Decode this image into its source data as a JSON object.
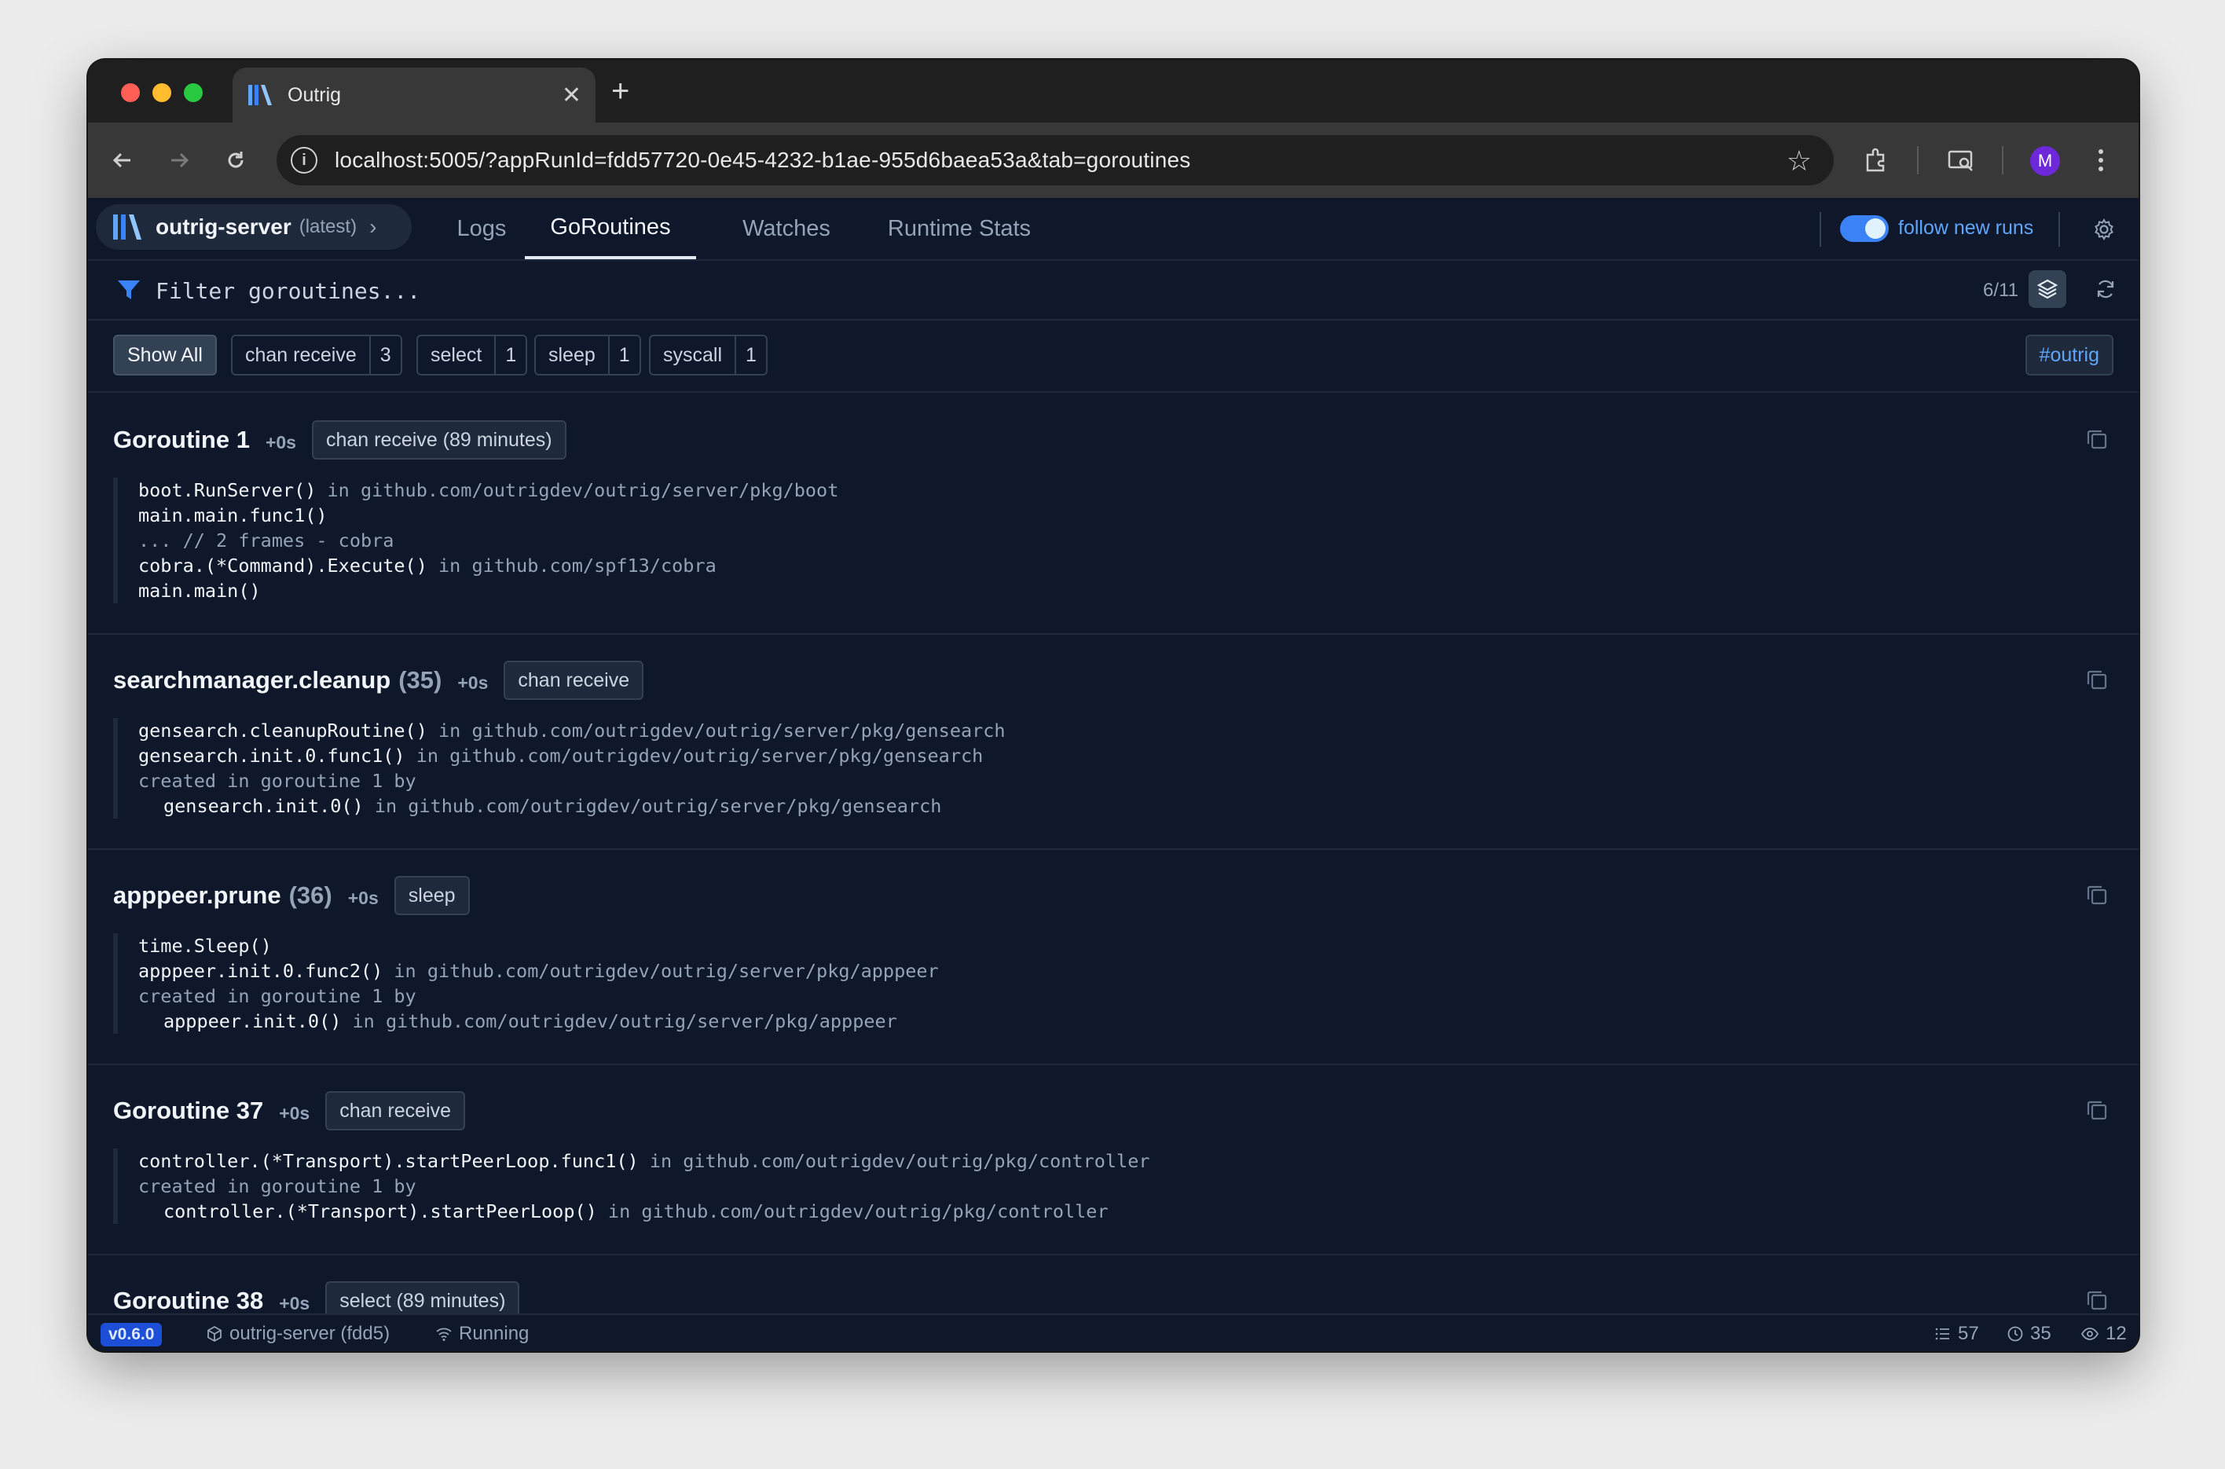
{
  "browser": {
    "tab_title": "Outrig",
    "url": "localhost:5005/?appRunId=fdd57720-0e45-4232-b1ae-955d6baea53a&tab=goroutines",
    "avatar_letter": "M"
  },
  "app": {
    "name": "outrig-server",
    "name_tag": "(latest)",
    "tabs": [
      "Logs",
      "GoRoutines",
      "Watches",
      "Runtime Stats"
    ],
    "active_tab": "GoRoutines",
    "follow_label": "follow new runs",
    "filter_placeholder": "Filter goroutines...",
    "count": "6/11",
    "chips": [
      {
        "label": "Show All",
        "count": ""
      },
      {
        "label": "chan receive",
        "count": "3"
      },
      {
        "label": "select",
        "count": "1"
      },
      {
        "label": "sleep",
        "count": "1"
      },
      {
        "label": "syscall",
        "count": "1"
      }
    ],
    "hashtag": "#outrig"
  },
  "goroutines": [
    {
      "name": "Goroutine 1",
      "num": "",
      "age": "+0s",
      "state": "chan receive (89 minutes)",
      "frames": [
        {
          "fn": "boot.RunServer()",
          "in": " in github.com/outrigdev/outrig/server/pkg/boot",
          "style": ""
        },
        {
          "fn": "main.main.func1()",
          "in": "",
          "style": ""
        },
        {
          "fn": "... // 2 frames - cobra",
          "in": "",
          "style": "dim"
        },
        {
          "fn": "cobra.(*Command).Execute()",
          "in": " in github.com/spf13/cobra",
          "style": ""
        },
        {
          "fn": "main.main()",
          "in": "",
          "style": ""
        }
      ]
    },
    {
      "name": "searchmanager.cleanup",
      "num": "(35)",
      "age": "+0s",
      "state": "chan receive",
      "frames": [
        {
          "fn": "gensearch.cleanupRoutine()",
          "in": " in github.com/outrigdev/outrig/server/pkg/gensearch",
          "style": ""
        },
        {
          "fn": "gensearch.init.0.func1()",
          "in": " in github.com/outrigdev/outrig/server/pkg/gensearch",
          "style": ""
        },
        {
          "fn": "created in goroutine 1 by",
          "in": "",
          "style": "dim"
        },
        {
          "fn": "gensearch.init.0()",
          "in": " in github.com/outrigdev/outrig/server/pkg/gensearch",
          "style": "ind"
        }
      ]
    },
    {
      "name": "apppeer.prune",
      "num": "(36)",
      "age": "+0s",
      "state": "sleep",
      "frames": [
        {
          "fn": "time.Sleep()",
          "in": "",
          "style": ""
        },
        {
          "fn": "apppeer.init.0.func2()",
          "in": " in github.com/outrigdev/outrig/server/pkg/apppeer",
          "style": ""
        },
        {
          "fn": "created in goroutine 1 by",
          "in": "",
          "style": "dim"
        },
        {
          "fn": "apppeer.init.0()",
          "in": " in github.com/outrigdev/outrig/server/pkg/apppeer",
          "style": "ind"
        }
      ]
    },
    {
      "name": "Goroutine 37",
      "num": "",
      "age": "+0s",
      "state": "chan receive",
      "frames": [
        {
          "fn": "controller.(*Transport).startPeerLoop.func1()",
          "in": " in github.com/outrigdev/outrig/pkg/controller",
          "style": ""
        },
        {
          "fn": "created in goroutine 1 by",
          "in": "",
          "style": "dim"
        },
        {
          "fn": "controller.(*Transport).startPeerLoop()",
          "in": " in github.com/outrigdev/outrig/pkg/controller",
          "style": "ind"
        }
      ]
    },
    {
      "name": "Goroutine 38",
      "num": "",
      "age": "+0s",
      "state": "select (89 minutes)",
      "frames": []
    }
  ],
  "status": {
    "version": "v0.6.0",
    "app": "outrig-server (fdd5)",
    "state": "Running",
    "logs": "57",
    "goroutines": "35",
    "watches": "12"
  },
  "colors": {
    "accent": "#3b82f6",
    "background": "#0f172a",
    "border": "#1e293b"
  }
}
